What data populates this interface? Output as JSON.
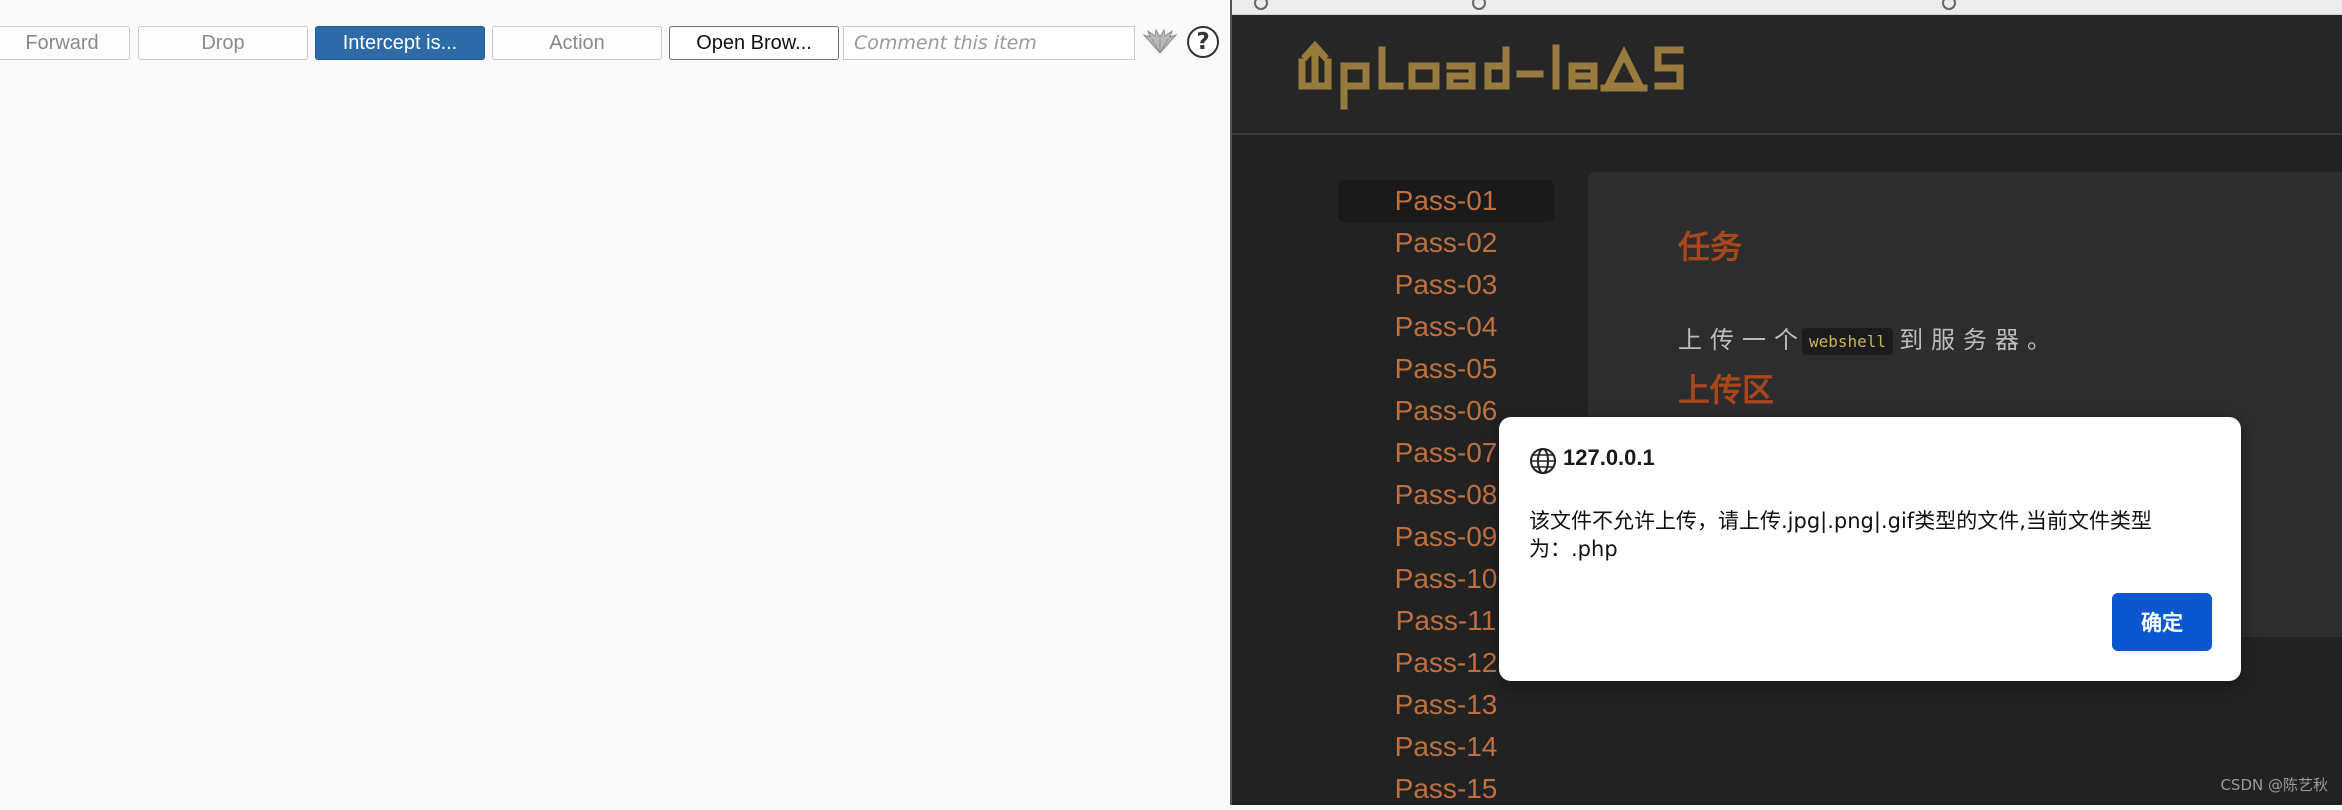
{
  "burp_toolbar": {
    "forward_label": "Forward",
    "drop_label": "Drop",
    "intercept_label": "Intercept is...",
    "action_label": "Action",
    "open_browser_label": "Open Brow...",
    "comment_placeholder": "Comment this item",
    "comment_value": "",
    "help_glyph": "?"
  },
  "site": {
    "logo_text": "upload-labs",
    "pass_items": [
      "Pass-01",
      "Pass-02",
      "Pass-03",
      "Pass-04",
      "Pass-05",
      "Pass-06",
      "Pass-07",
      "Pass-08",
      "Pass-09",
      "Pass-10",
      "Pass-11",
      "Pass-12",
      "Pass-13",
      "Pass-14",
      "Pass-15"
    ],
    "active_pass": "Pass-01",
    "task_title": "任务",
    "task_prefix": "上传一个",
    "task_code": "webshell",
    "task_suffix": "到服务器。",
    "upload_title": "上传区"
  },
  "alert": {
    "origin": "127.0.0.1",
    "message": "该文件不允许上传，请上传.jpg|.png|.gif类型的文件,当前文件类型为：.php",
    "ok_label": "确定"
  },
  "watermark": "CSDN @陈艺秋",
  "colors": {
    "accent_blue": "#2c6aa8",
    "pass_orange": "#c0703f",
    "title_orange": "#a7471b",
    "logo_gold": "#9a7b3e",
    "dialog_button": "#0b57d0"
  },
  "icons": {
    "toolbar_logo": "burp-wings-icon",
    "help": "help-icon",
    "origin": "globe-icon"
  }
}
